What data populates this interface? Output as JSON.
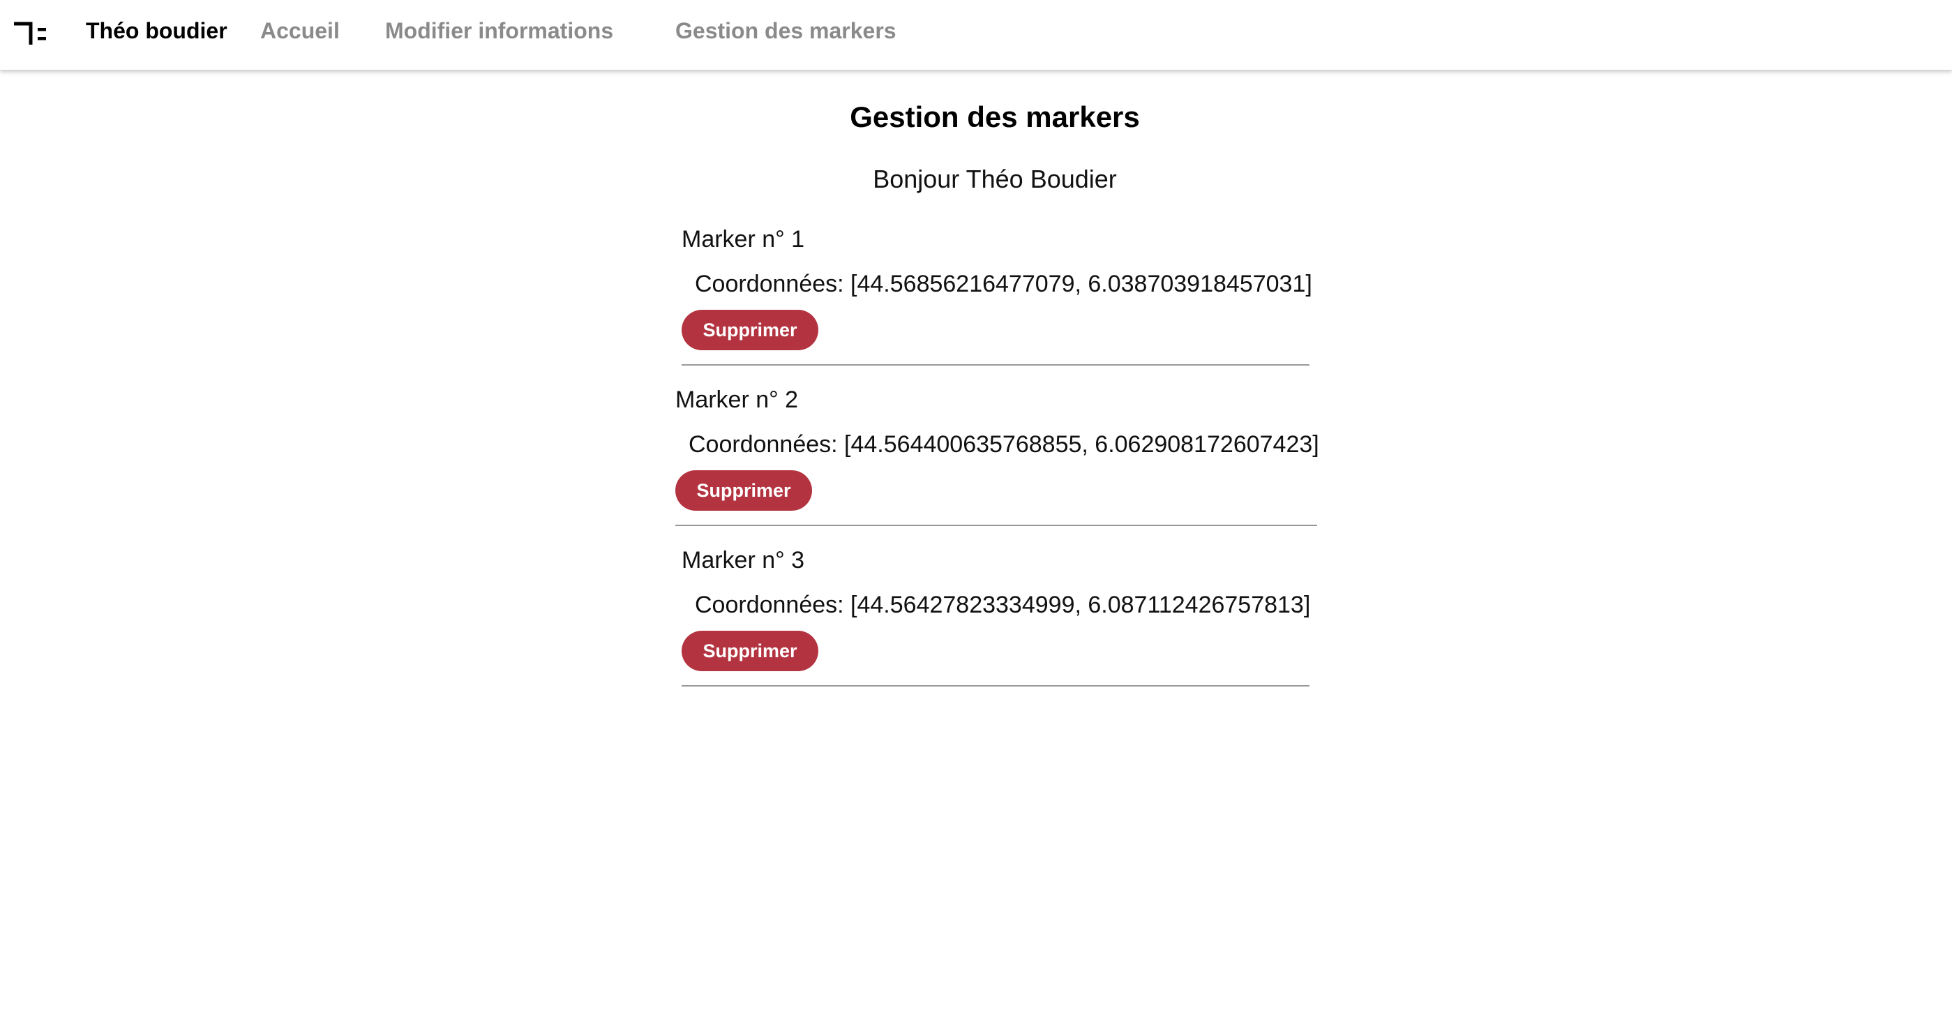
{
  "navbar": {
    "logo_icon": "brand-logo-icon",
    "brand": "Théo boudier",
    "links": [
      "Accueil",
      "Modifier informations",
      "Gestion des markers"
    ]
  },
  "main": {
    "title": "Gestion des markers",
    "greeting": "Bonjour Théo Boudier",
    "markers": [
      {
        "title": "Marker n° 1",
        "coords": "Coordonnées: [44.56856216477079, 6.038703918457031]",
        "delete_label": "Supprimer"
      },
      {
        "title": "Marker n° 2",
        "coords": "Coordonnées: [44.564400635768855, 6.062908172607423]",
        "delete_label": "Supprimer"
      },
      {
        "title": "Marker n° 3",
        "coords": "Coordonnées: [44.56427823334999, 6.087112426757813]",
        "delete_label": "Supprimer"
      }
    ]
  },
  "colors": {
    "button_bg": "#b33440",
    "nav_link": "#8a8a8a",
    "divider": "#9a9a9a"
  }
}
